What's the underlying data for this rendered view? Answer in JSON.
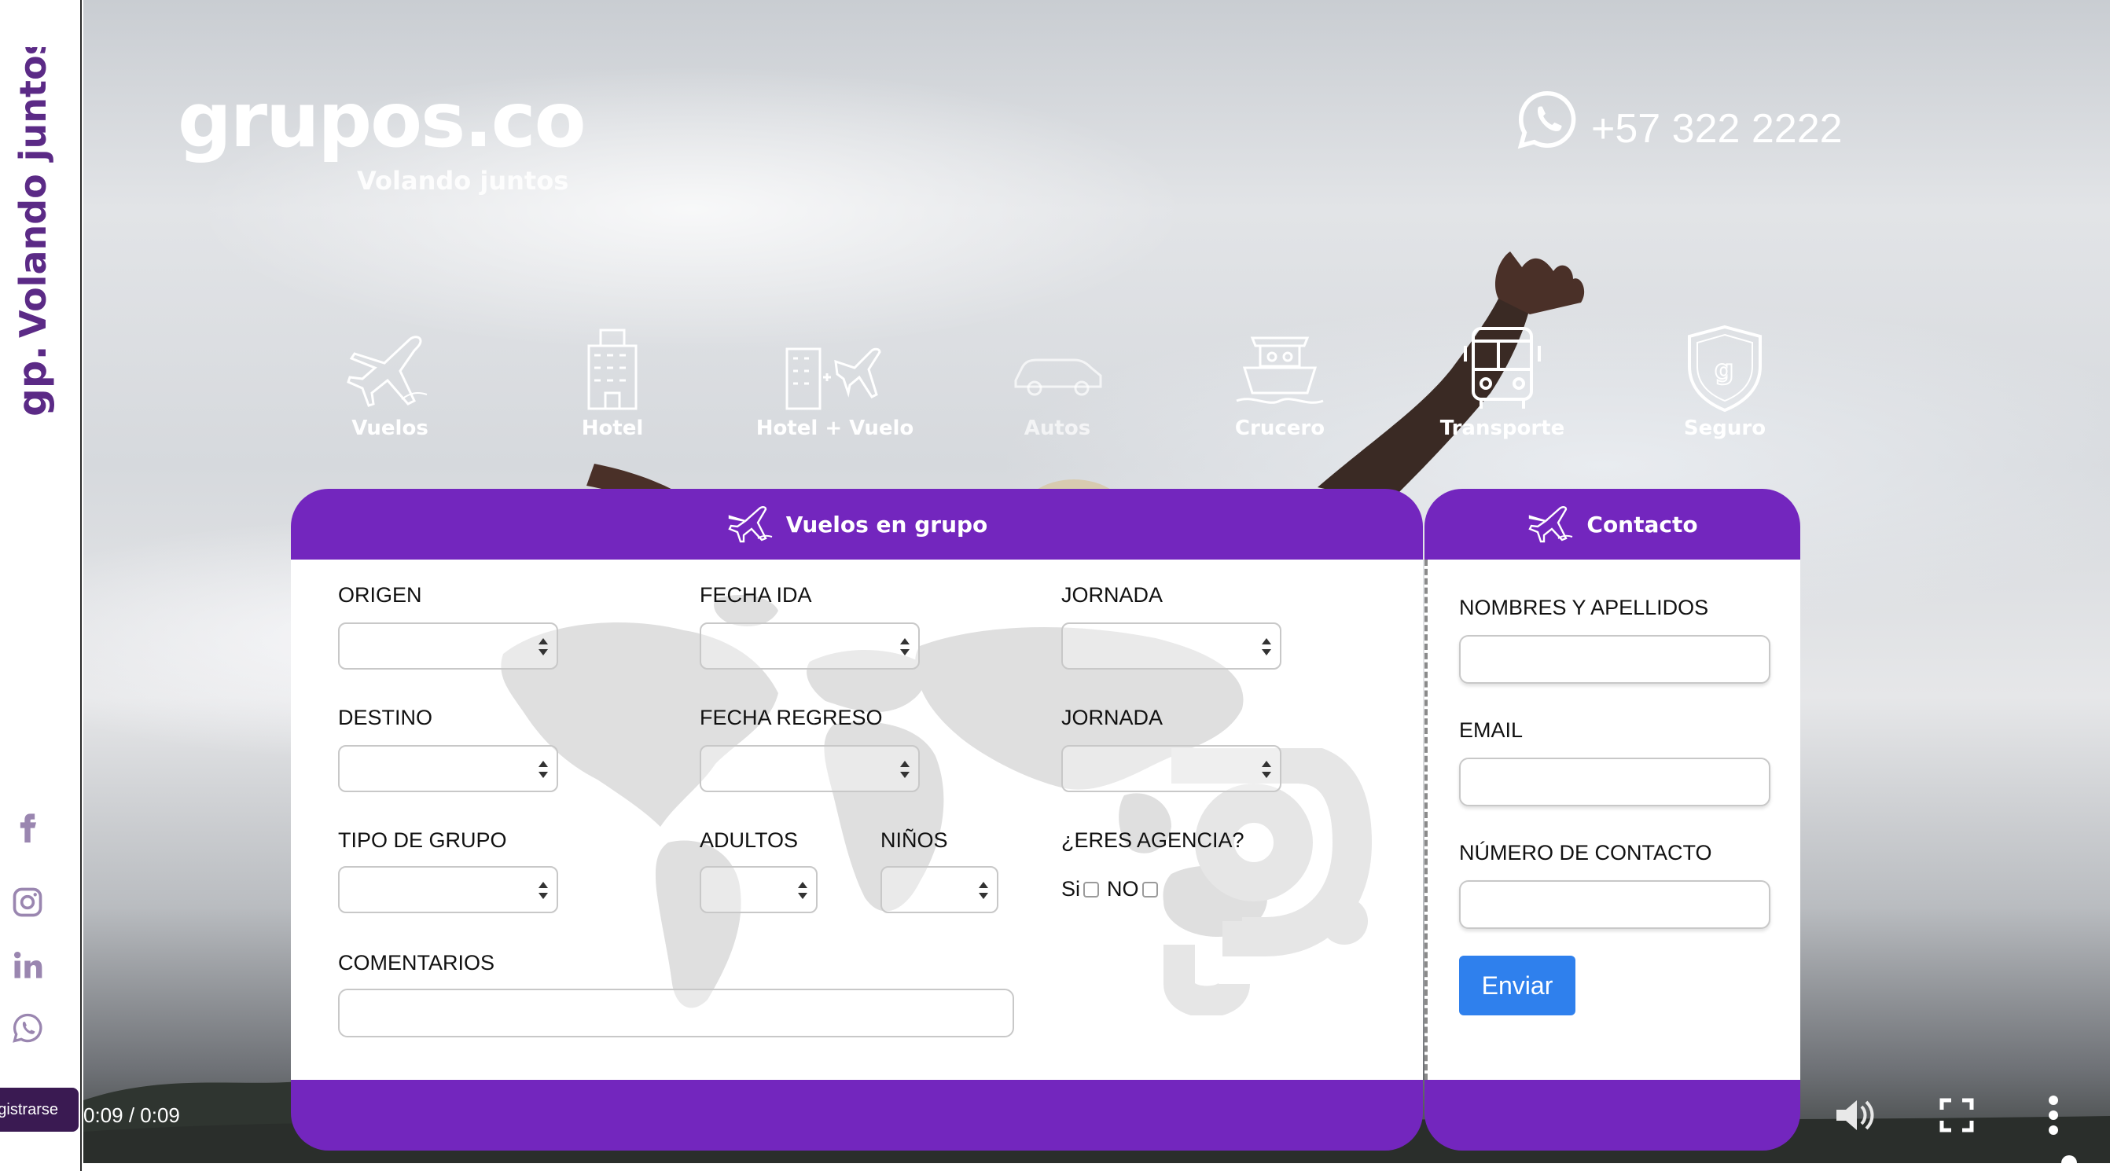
{
  "sidebar": {
    "brand_vertical": "Volando juntos",
    "social": [
      "facebook-icon",
      "instagram-icon",
      "linkedin-icon",
      "whatsapp-icon"
    ],
    "register_label": "gistrarse"
  },
  "header": {
    "logo_text": "grupos.co",
    "logo_tagline": "Volando juntos",
    "phone": "+57 322 2222"
  },
  "services": [
    {
      "label": "Vuelos",
      "icon": "airplane-icon"
    },
    {
      "label": "Hotel",
      "icon": "hotel-icon"
    },
    {
      "label": "Hotel + Vuelo",
      "icon": "hotel-flight-icon"
    },
    {
      "label": "Autos",
      "icon": "car-icon"
    },
    {
      "label": "Crucero",
      "icon": "cruise-icon"
    },
    {
      "label": "Transporte",
      "icon": "bus-icon"
    },
    {
      "label": "Seguro",
      "icon": "shield-icon"
    }
  ],
  "form": {
    "title": "Vuelos en grupo",
    "fields": {
      "origen": "ORIGEN",
      "fecha_ida": "FECHA IDA",
      "jornada_ida": "JORNADA",
      "destino": "DESTINO",
      "fecha_regreso": "FECHA REGRESO",
      "jornada_regreso": "JORNADA",
      "tipo_grupo": "TIPO DE GRUPO",
      "adultos": "ADULTOS",
      "ninos": "NIÑOS",
      "agencia": "¿ERES AGENCIA?",
      "comentarios": "COMENTARIOS"
    },
    "agencia_options": {
      "si": "Si",
      "no": "NO"
    }
  },
  "contact": {
    "title": "Contacto",
    "nombres_label": "NOMBRES Y APELLIDOS",
    "email_label": "EMAIL",
    "numero_label": "NÚMERO DE CONTACTO",
    "submit_label": "Enviar"
  },
  "video": {
    "time": "0:09 / 0:09",
    "progress": 1.0
  },
  "colors": {
    "brand_purple": "#7326be",
    "button_blue": "#2f80ed",
    "sidebar_brand": "#5b2a86"
  }
}
